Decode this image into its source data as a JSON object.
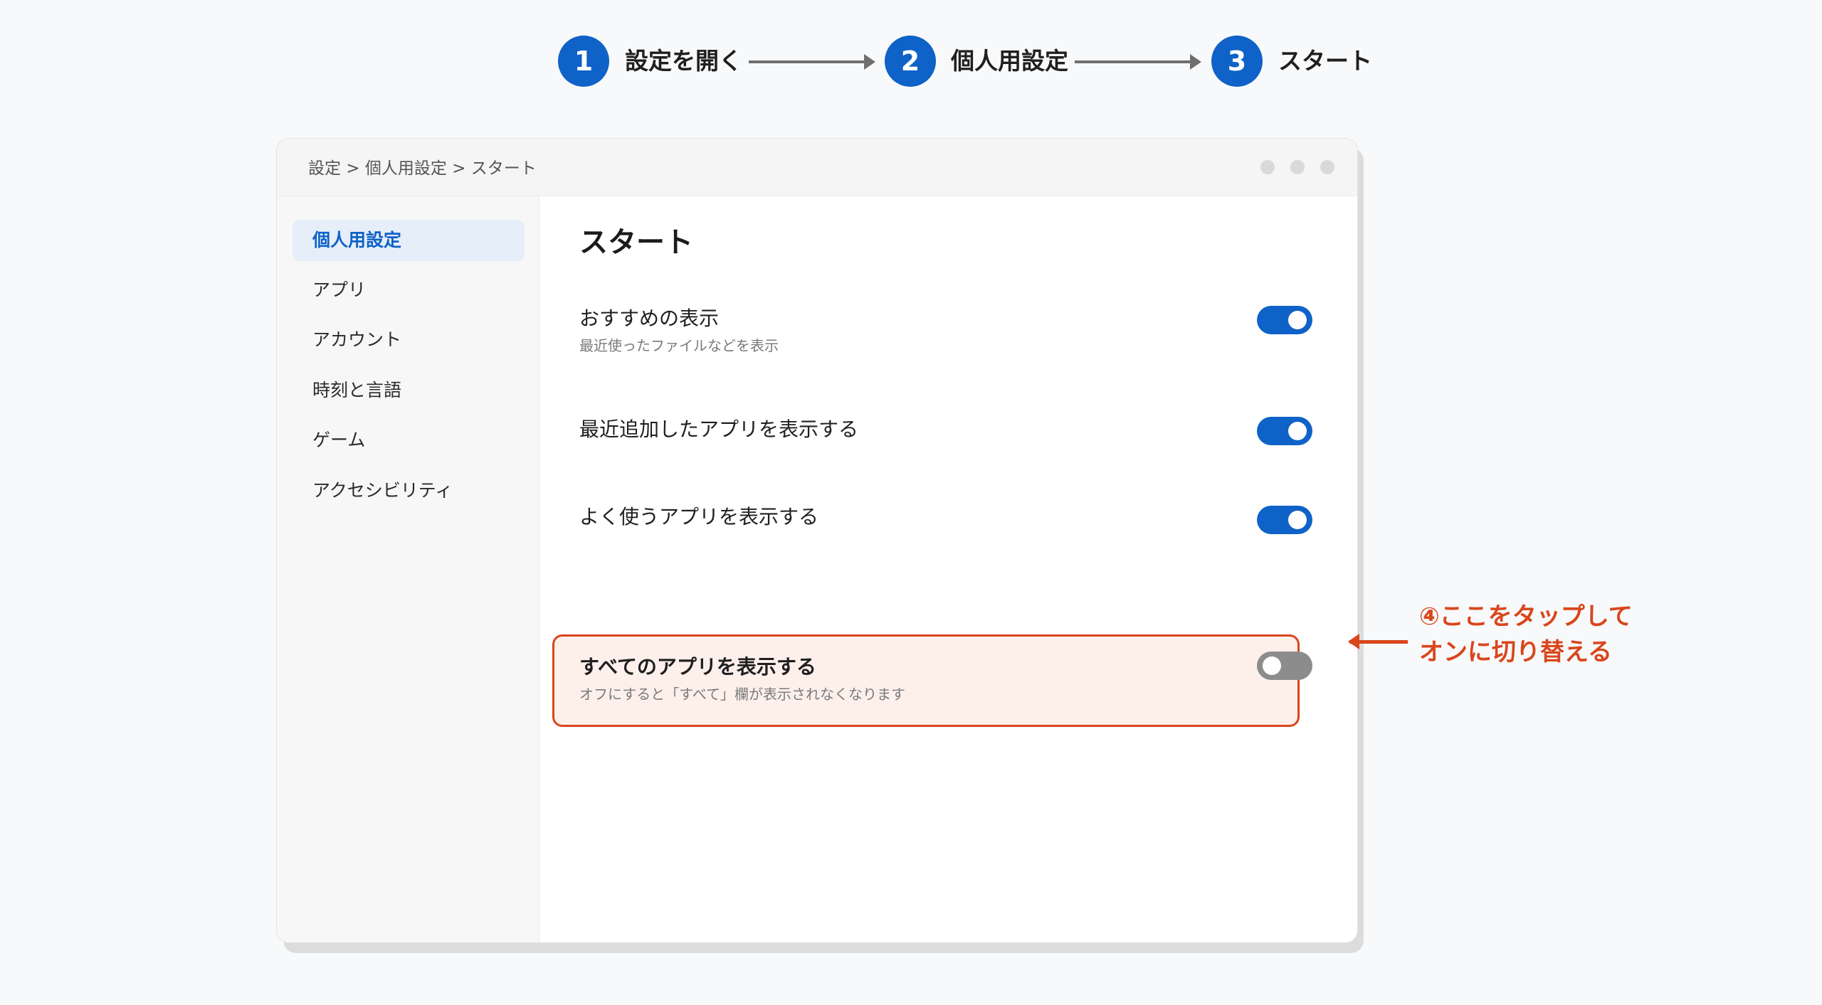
{
  "steps": [
    {
      "number": "1",
      "label": "設定を開く"
    },
    {
      "number": "2",
      "label": "個人用設定"
    },
    {
      "number": "3",
      "label": "スタート"
    }
  ],
  "window": {
    "breadcrumb": "設定 > 個人用設定 > スタート"
  },
  "sidebar": {
    "items": [
      {
        "label": "個人用設定",
        "active": true
      },
      {
        "label": "アプリ",
        "active": false
      },
      {
        "label": "アカウント",
        "active": false
      },
      {
        "label": "時刻と言語",
        "active": false
      },
      {
        "label": "ゲーム",
        "active": false
      },
      {
        "label": "アクセシビリティ",
        "active": false
      }
    ]
  },
  "content": {
    "title": "スタート",
    "settings": [
      {
        "title": "おすすめの表示",
        "description": "最近使ったファイルなどを表示",
        "on": true
      },
      {
        "title": "最近追加したアプリを表示する",
        "on": true
      },
      {
        "title": "よく使うアプリを表示する",
        "on": true
      },
      {
        "title": "すべてのアプリを表示する",
        "description": "オフにすると「すべて」欄が表示されなくなります",
        "on": false,
        "highlighted": true
      }
    ]
  },
  "callout": {
    "line1": "④ここをタップして",
    "line2": "オンに切り替える"
  },
  "colors": {
    "accent": "#0f62c7",
    "highlight": "#d9461c",
    "highlight_bg": "#fdf0eb",
    "toggle_off": "#8c8c8c"
  }
}
